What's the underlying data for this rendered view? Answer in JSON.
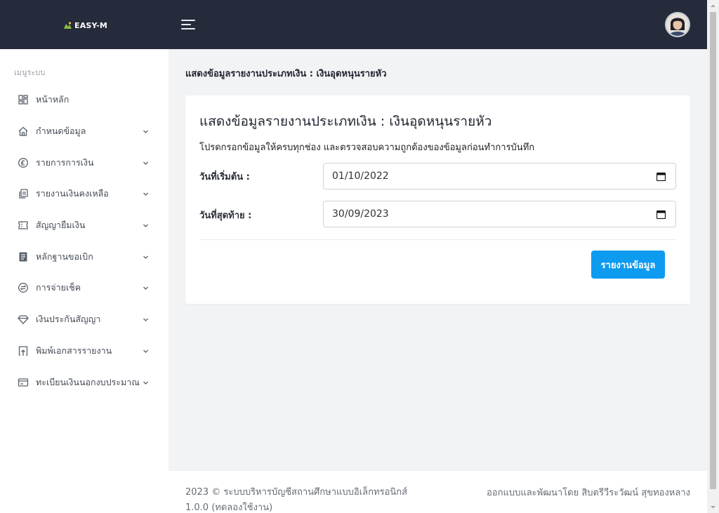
{
  "brand": {
    "name": "EASY-M"
  },
  "sidebar": {
    "header": "เมนูระบบ",
    "items": [
      {
        "label": "หน้าหลัก",
        "icon": "dashboard-icon",
        "has_submenu": false
      },
      {
        "label": "กำหนดข้อมูล",
        "icon": "home-icon",
        "has_submenu": true
      },
      {
        "label": "รายการการเงิน",
        "icon": "coin-icon",
        "has_submenu": true
      },
      {
        "label": "รายงานเงินคงเหลือ",
        "icon": "files-icon",
        "has_submenu": true
      },
      {
        "label": "สัญญายืมเงิน",
        "icon": "ticket-icon",
        "has_submenu": true
      },
      {
        "label": "หลักฐานขอเบิก",
        "icon": "document-icon",
        "has_submenu": true
      },
      {
        "label": "การจ่ายเช็ค",
        "icon": "exchange-icon",
        "has_submenu": true
      },
      {
        "label": "เงินประกันสัญญา",
        "icon": "diamond-icon",
        "has_submenu": true
      },
      {
        "label": "พิมพ์เอกสารรายงาน",
        "icon": "print-upload-icon",
        "has_submenu": true
      },
      {
        "label": "ทะเบียนเงินนอกงบประมาณ",
        "icon": "card-icon",
        "has_submenu": true
      }
    ]
  },
  "main": {
    "page_title": "แสดงข้อมูลรายงานประเภทเงิน : เงินอุดหนุนรายหัว",
    "card": {
      "title": "แสดงข้อมูลรายงานประเภทเงิน : เงินอุดหนุนรายหัว",
      "description": "โปรดกรอกข้อมูลให้ครบทุกช่อง และตรวจสอบความถูกต้องของข้อมูลก่อนทำการบันทึก",
      "start_date": {
        "label": "วันที่เริ่มต้น :",
        "value": "01/10/2022"
      },
      "end_date": {
        "label": "วันที่สุดท้าย :",
        "value": "30/09/2023"
      },
      "submit_label": "รายงานข้อมูล"
    }
  },
  "footer": {
    "copyright": "2023 © ระบบบริหารบัญชีสถานศึกษาแบบอิเล็กทรอนิกส์",
    "version": "1.0.0 (ทดลองใช้งาน)",
    "credit": "ออกแบบและพัฒนาโดย สิบตรีวีระวัฒน์ สุขทองหลาง"
  },
  "colors": {
    "navbar": "#252b3a",
    "accent_button": "#0d9bf0",
    "background": "#f2f3f5"
  }
}
